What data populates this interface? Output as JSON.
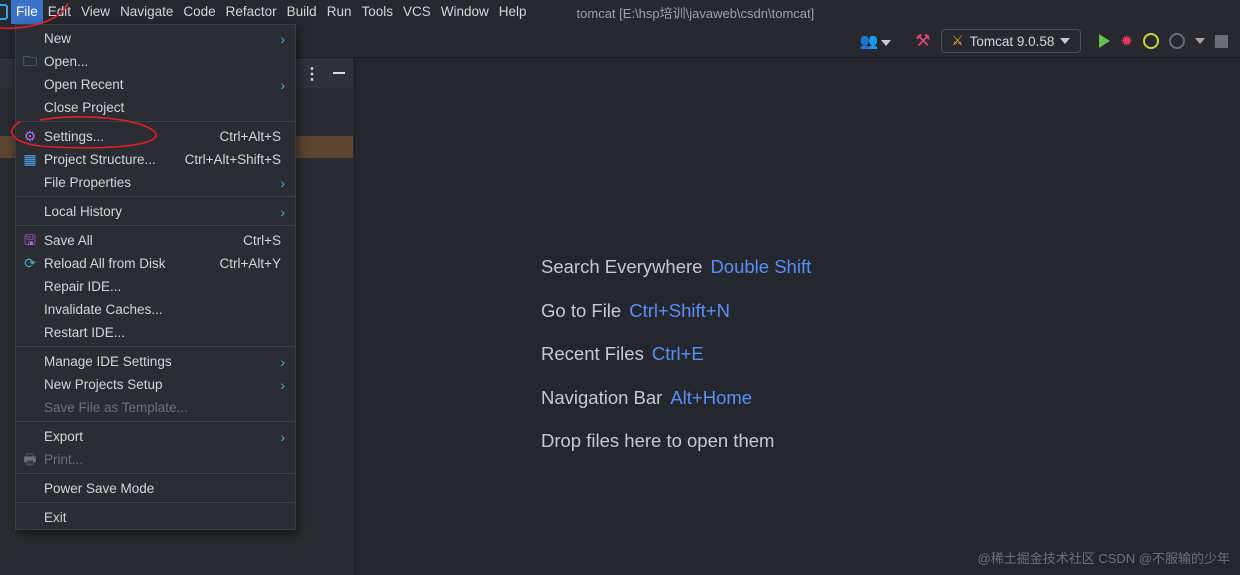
{
  "menubar": {
    "items": [
      "File",
      "Edit",
      "View",
      "Navigate",
      "Code",
      "Refactor",
      "Build",
      "Run",
      "Tools",
      "VCS",
      "Window",
      "Help"
    ],
    "title": "tomcat [E:\\hsp培训\\javaweb\\csdn\\tomcat]"
  },
  "toolbar": {
    "run_config": "Tomcat 9.0.58",
    "icons": [
      "users-icon",
      "hammer-icon",
      "tomcat-icon",
      "run-icon",
      "debug-icon",
      "coverage-icon",
      "profiler-icon",
      "stop-icon"
    ]
  },
  "file_menu": {
    "items": [
      {
        "label": "New",
        "sub": true
      },
      {
        "label": "Open...",
        "icon": "folder-icon"
      },
      {
        "label": "Open Recent",
        "sub": true
      },
      {
        "label": "Close Project"
      },
      {
        "sep": true
      },
      {
        "label": "Settings...",
        "shortcut": "Ctrl+Alt+S",
        "icon": "gear-icon"
      },
      {
        "label": "Project Structure...",
        "shortcut": "Ctrl+Alt+Shift+S",
        "icon": "grid-icon"
      },
      {
        "label": "File Properties",
        "sub": true
      },
      {
        "sep": true
      },
      {
        "label": "Local History",
        "sub": true
      },
      {
        "sep": true
      },
      {
        "label": "Save All",
        "shortcut": "Ctrl+S",
        "icon": "save-icon"
      },
      {
        "label": "Reload All from Disk",
        "shortcut": "Ctrl+Alt+Y",
        "icon": "reload-icon"
      },
      {
        "label": "Repair IDE..."
      },
      {
        "label": "Invalidate Caches..."
      },
      {
        "label": "Restart IDE..."
      },
      {
        "sep": true
      },
      {
        "label": "Manage IDE Settings",
        "sub": true
      },
      {
        "label": "New Projects Setup",
        "sub": true
      },
      {
        "label": "Save File as Template...",
        "disabled": true
      },
      {
        "sep": true
      },
      {
        "label": "Export",
        "sub": true
      },
      {
        "label": "Print...",
        "disabled": true,
        "icon": "print-icon"
      },
      {
        "sep": true
      },
      {
        "label": "Power Save Mode"
      },
      {
        "sep": true
      },
      {
        "label": "Exit"
      }
    ]
  },
  "welcome": [
    {
      "text": "Search Everywhere",
      "key": "Double Shift"
    },
    {
      "text": "Go to File",
      "key": "Ctrl+Shift+N"
    },
    {
      "text": "Recent Files",
      "key": "Ctrl+E"
    },
    {
      "text": "Navigation Bar",
      "key": "Alt+Home"
    },
    {
      "text": "Drop files here to open them",
      "key": ""
    }
  ],
  "watermark": "@稀土掘金技术社区 CSDN @不服输的少年",
  "colors": {
    "accent": "#3a72c9",
    "shortcut": "#5a8ff5",
    "annotation": "#e0202a"
  }
}
